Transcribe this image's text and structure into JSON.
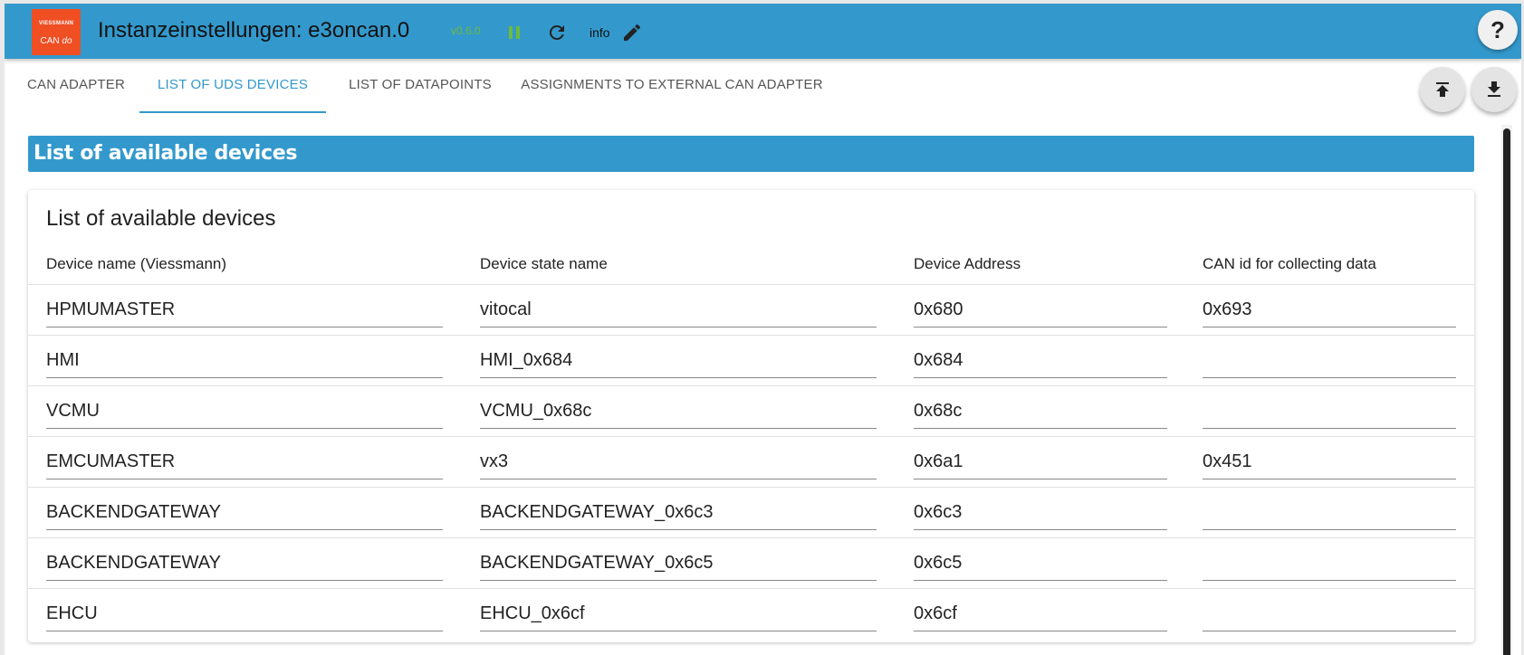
{
  "header": {
    "logo_top": "VIESSMANN",
    "logo_bottom_a": "CAN ",
    "logo_bottom_b": "do",
    "title": "Instanzeinstellungen: e3oncan.0",
    "version": "v0.6.0",
    "info_label": "info",
    "help_label": "?",
    "icons": [
      "pause-icon",
      "refresh-icon",
      "edit-icon",
      "help-icon"
    ]
  },
  "tabs": [
    {
      "label": "CAN ADAPTER"
    },
    {
      "label": "LIST OF UDS DEVICES"
    },
    {
      "label": "LIST OF DATAPOINTS"
    },
    {
      "label": "ASSIGNMENTS TO EXTERNAL CAN ADAPTER"
    }
  ],
  "active_tab": 1,
  "section": {
    "title": "List of available devices"
  },
  "card": {
    "title": "List of available devices",
    "columns": [
      "Device name (Viessmann)",
      "Device state name",
      "Device Address",
      "CAN id for collecting data"
    ],
    "rows": [
      [
        "HPMUMASTER",
        "vitocal",
        "0x680",
        "0x693"
      ],
      [
        "HMI",
        "HMI_0x684",
        "0x684",
        ""
      ],
      [
        "VCMU",
        "VCMU_0x68c",
        "0x68c",
        ""
      ],
      [
        "EMCUMASTER",
        "vx3",
        "0x6a1",
        "0x451"
      ],
      [
        "BACKENDGATEWAY",
        "BACKENDGATEWAY_0x6c3",
        "0x6c3",
        ""
      ],
      [
        "BACKENDGATEWAY",
        "BACKENDGATEWAY_0x6c5",
        "0x6c5",
        ""
      ],
      [
        "EHCU",
        "EHCU_0x6cf",
        "0x6cf",
        ""
      ]
    ]
  },
  "colors": {
    "accent": "#3399cc",
    "logo": "#f04e23",
    "version": "#6dbb3a"
  }
}
